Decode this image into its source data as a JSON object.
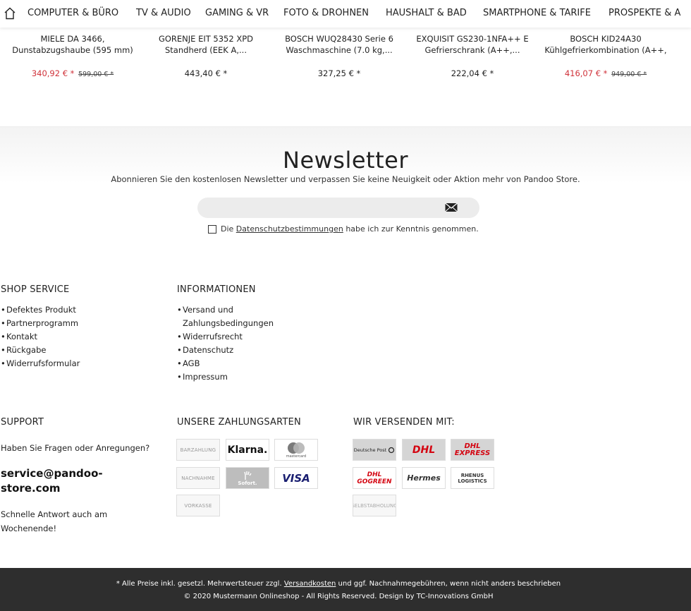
{
  "nav": {
    "items": [
      "COMPUTER & BÜRO",
      "TV & AUDIO",
      "GAMING & VR",
      "FOTO & DROHNEN",
      "HAUSHALT & BAD",
      "SMARTPHONE & TARIFE",
      "PROSPEKTE & A"
    ]
  },
  "products": [
    {
      "line1": "MIELE DA 3466,",
      "line2": "Dunstabzugshaube (595 mm)",
      "price": "340,92 € *",
      "old_price": "599,00 € *"
    },
    {
      "line1": "GORENJE EIT 5352 XPD",
      "line2": "Standherd (EEK A,...",
      "price": "443,40 € *",
      "old_price": ""
    },
    {
      "line1": "BOSCH WUQ28430 Serie 6",
      "line2": "Waschmaschine (7.0 kg,...",
      "price": "327,25 € *",
      "old_price": ""
    },
    {
      "line1": "EXQUISIT GS230-1NFA++ E",
      "line2": "Gefrierschrank (A++,...",
      "price": "222,04 € *",
      "old_price": ""
    },
    {
      "line1": "BOSCH KID24A30",
      "line2": "Kühlgefrierkombination (A++,",
      "price": "416,07 € *",
      "old_price": "949,00 € *"
    }
  ],
  "newsletter": {
    "title": "Newsletter",
    "subtitle": "Abonnieren Sie den kostenlosen Newsletter und verpassen Sie keine Neuigkeit oder Aktion mehr von Pandoo Store.",
    "email_value": "",
    "consent_prefix": "Die",
    "consent_link": "Datenschutzbestimmungen",
    "consent_suffix": "habe ich zur Kenntnis genommen."
  },
  "shop_service": {
    "heading": "SHOP SERVICE",
    "links": [
      "Defektes Produkt",
      "Partnerprogramm",
      "Kontakt",
      "Rückgabe",
      "Widerrufsformular"
    ]
  },
  "informationen": {
    "heading": "INFORMATIONEN",
    "links": [
      "Versand und Zahlungsbedingungen",
      "Widerrufsrecht",
      "Datenschutz",
      "AGB",
      "Impressum"
    ]
  },
  "support": {
    "heading": "SUPPORT",
    "question": "Haben Sie Fragen oder Anregungen?",
    "email": "service@pandoo-store.com",
    "note": "Schnelle Antwort auch am Wochenende!"
  },
  "payment": {
    "heading": "UNSERE ZAHLUNGSARTEN",
    "methods": [
      "BARZAHLUNG",
      "Klarna.",
      "mastercard",
      "NACHNAHME",
      "Sofort.",
      "VISA",
      "VORKASSE"
    ]
  },
  "shipping": {
    "heading": "WIR VERSENDEN MIT:",
    "carriers": [
      "Deutsche Post",
      "DHL",
      "DHL EXPRESS",
      "DHL GOGREEN",
      "Hermes",
      "RHENUS LOGISTICS",
      "SELBSTABHOLUNG"
    ]
  },
  "bottom": {
    "line1_prefix": "* Alle Preise inkl. gesetzl. Mehrwertsteuer zzgl.",
    "line1_link": "Versandkosten",
    "line1_suffix": "und ggf. Nachnahmegebühren, wenn nicht anders beschrieben",
    "line2": "© 2020 Mustermann Onlineshop - All Rights Reserved. Design by TC-Innovations GmbH"
  },
  "colors": {
    "sale_price": "#d0323a",
    "footer_bar": "#2e2e2e",
    "dhl_red": "#d40511",
    "visa_blue": "#1a1f71"
  }
}
